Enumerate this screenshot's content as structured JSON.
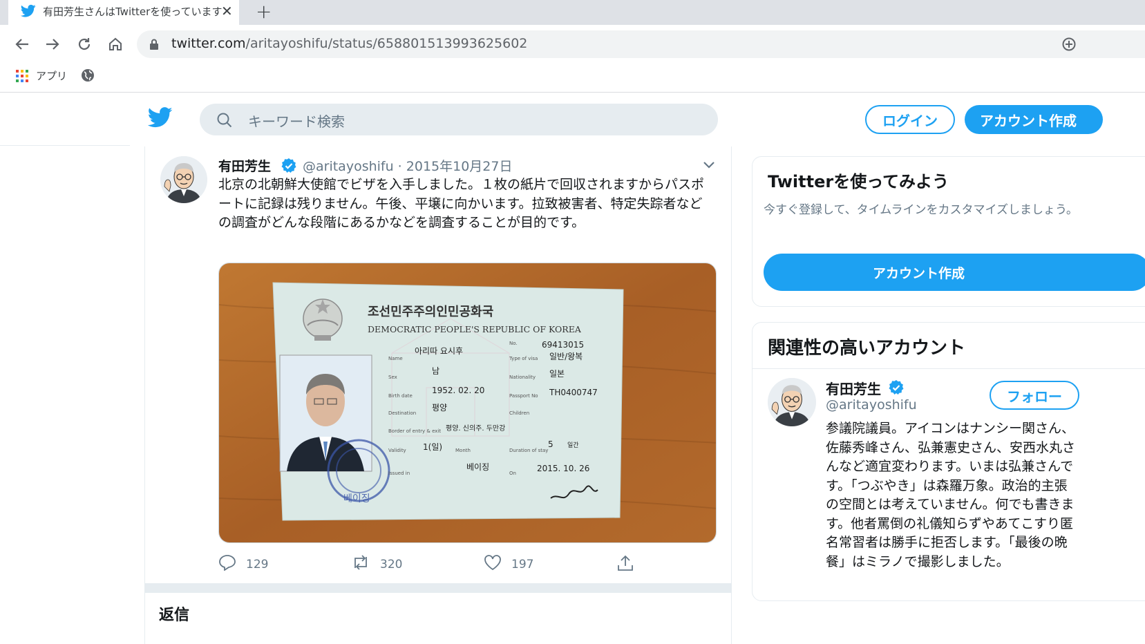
{
  "browser": {
    "tab_title": "有田芳生さんはTwitterを使っています",
    "new_tab_label": "+",
    "close_label": "✕",
    "url_domain": "twitter.com",
    "url_path": "/aritayoshifu/status/658801513993625602",
    "bookmarks": [
      {
        "label": "アプリ"
      }
    ]
  },
  "header": {
    "search_placeholder": "キーワード検索",
    "login_label": "ログイン",
    "signup_label": "アカウント作成"
  },
  "tweet": {
    "author_name": "有田芳生",
    "author_handle": "@aritayoshifu",
    "date": "2015年10月27日",
    "meta": "@aritayoshifu · 2015年10月27日",
    "text": "北京の北朝鮮大使館でビザを入手しました。１枚の紙片で回収されますからパスポートに記録は残りません。午後、平壌に向かいます。拉致被害者、特定失踪者などの調査がどんな段階にあるかなどを調査することが目的です。",
    "reply_count": "129",
    "retweet_count": "320",
    "like_count": "197",
    "visa": {
      "title_kr": "조선민주주의인민공화국",
      "title_en": "DEMOCRATIC PEOPLE'S REPUBLIC OF KOREA",
      "no": "69413015",
      "name": "아리따 요시후",
      "type": "일반/왕복",
      "sex": "남",
      "nationality": "일본",
      "birth": "1952. 02. 20",
      "passport_no": "TH0400747",
      "destination": "평양",
      "border": "평양. 신의주. 두만강",
      "validity": "1(일)",
      "duration": "5",
      "issued_in": "베이징",
      "issued_on": "2015. 10. 26",
      "labels": {
        "no": "No.",
        "name": "Name",
        "type": "Type of visa",
        "sex": "Sex",
        "nationality": "Nationality",
        "birth": "Birth date",
        "passport": "Passport No",
        "destination": "Destination",
        "children": "Children",
        "border": "Border of entry & exit",
        "validity": "Validity",
        "month": "Month",
        "duration": "Duration of stay",
        "days": "일간",
        "issued_in": "Issued in",
        "on": "On"
      },
      "colors": {
        "table": "#b46a2e",
        "paper": "#d7e8e4"
      }
    }
  },
  "replies_heading": "返信",
  "sidebar": {
    "join": {
      "title": "Twitterを使ってみよう",
      "description": "今すぐ登録して、タイムラインをカスタマイズしましょう。",
      "button": "アカウント作成"
    },
    "related": {
      "title": "関連性の高いアカウント",
      "name": "有田芳生",
      "handle": "@aritayoshifu",
      "follow_label": "フォロー",
      "bio": "参議院議員。アイコンはナンシー関さん、佐藤秀峰さん、弘兼憲史さん、安西水丸さんなど適宜変わります。いまは弘兼さんです。「つぶやき」は森羅万象。政治的主張の空間とは考えていません。何でも書きます。他者罵倒の礼儀知らずやあてこすり匿名常習者は勝手に拒否します。「最後の晩餐」はミラノで撮影しました。"
    }
  },
  "colors": {
    "accent": "#1da1f2",
    "muted": "#657786",
    "border": "#e6ecf0"
  }
}
